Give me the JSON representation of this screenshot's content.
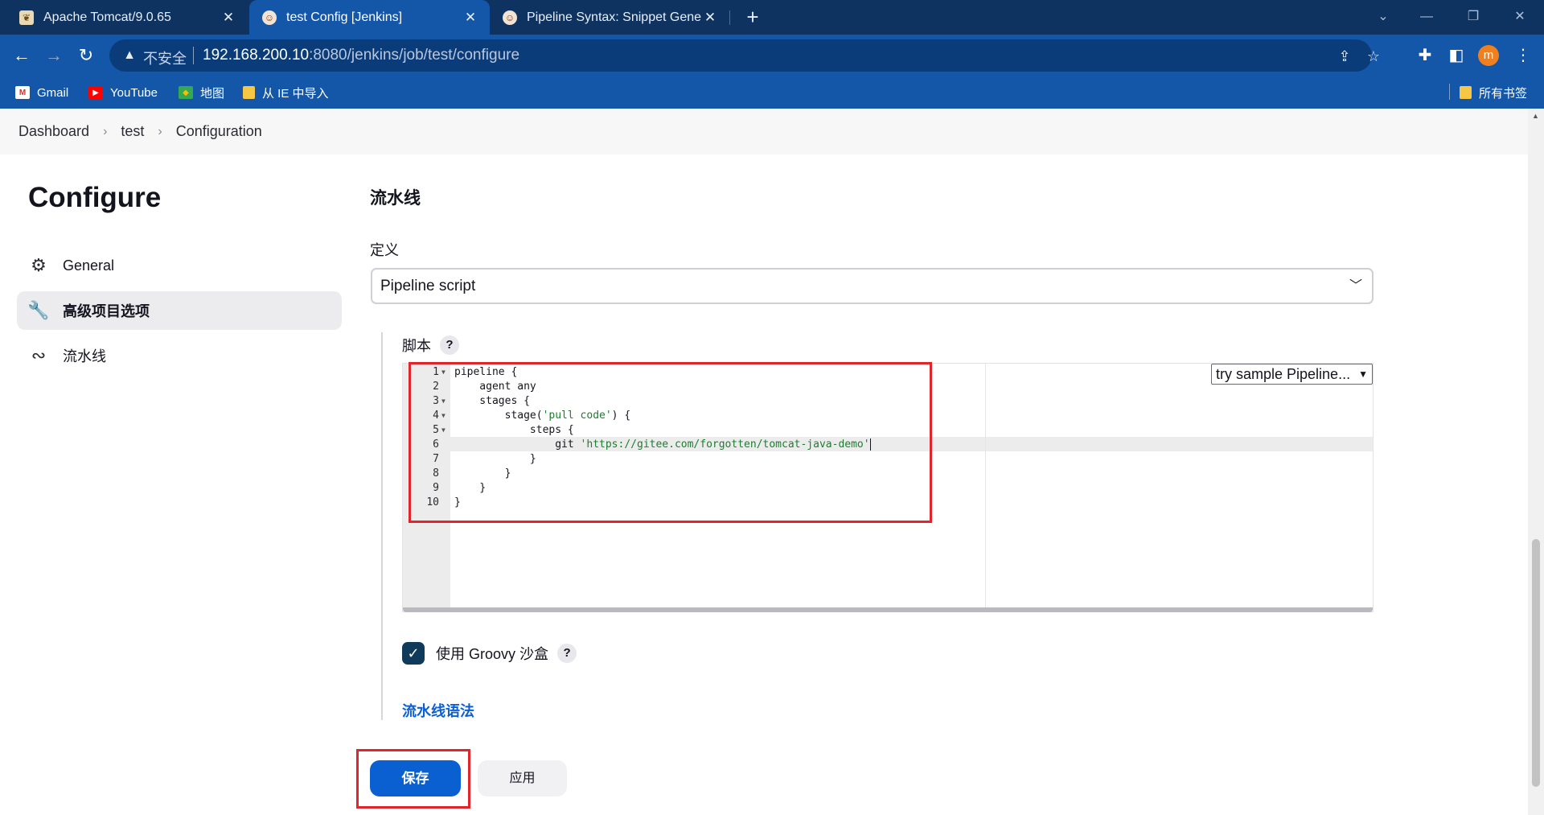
{
  "browser": {
    "tabs": [
      {
        "title": "Apache Tomcat/9.0.65",
        "favicon": "tomcat-icon",
        "active": false
      },
      {
        "title": "test Config [Jenkins]",
        "favicon": "jenkins-icon",
        "active": true
      },
      {
        "title": "Pipeline Syntax: Snippet Gene",
        "favicon": "jenkins-icon",
        "active": false
      }
    ],
    "address": {
      "security_label": "不安全",
      "host": "192.168.200.10",
      "path": ":8080/jenkins/job/test/configure"
    },
    "avatar_letter": "m",
    "bookmarks": [
      {
        "label": "Gmail",
        "icon": "gmail-icon"
      },
      {
        "label": "YouTube",
        "icon": "youtube-icon"
      },
      {
        "label": "地图",
        "icon": "maps-icon"
      },
      {
        "label": "从 IE 中导入",
        "icon": "folder-icon"
      }
    ],
    "all_bookmarks_label": "所有书签"
  },
  "breadcrumb": [
    "Dashboard",
    "test",
    "Configuration"
  ],
  "sidebar": {
    "title": "Configure",
    "items": [
      {
        "label": "General",
        "icon": "gear-icon",
        "active": false
      },
      {
        "label": "高级项目选项",
        "icon": "wrench-icon",
        "active": true
      },
      {
        "label": "流水线",
        "icon": "pipeline-icon",
        "active": false
      }
    ]
  },
  "pipeline": {
    "section_title": "流水线",
    "definition_label": "定义",
    "definition_value": "Pipeline script",
    "script_label": "脚本",
    "sample_select_value": "try sample Pipeline...",
    "code": [
      {
        "n": "1",
        "fold": true,
        "pre": "pipeline {",
        "str": "",
        "post": ""
      },
      {
        "n": "2",
        "fold": false,
        "pre": "    agent any",
        "str": "",
        "post": ""
      },
      {
        "n": "3",
        "fold": true,
        "pre": "    stages {",
        "str": "",
        "post": ""
      },
      {
        "n": "4",
        "fold": true,
        "pre": "        stage(",
        "str": "'pull code'",
        "post": ") {"
      },
      {
        "n": "5",
        "fold": true,
        "pre": "            steps {",
        "str": "",
        "post": ""
      },
      {
        "n": "6",
        "fold": false,
        "pre": "                git ",
        "str": "'https://gitee.com/forgotten/tomcat-java-demo'",
        "post": ""
      },
      {
        "n": "7",
        "fold": false,
        "pre": "            }",
        "str": "",
        "post": ""
      },
      {
        "n": "8",
        "fold": false,
        "pre": "        }",
        "str": "",
        "post": ""
      },
      {
        "n": "9",
        "fold": false,
        "pre": "    }",
        "str": "",
        "post": ""
      },
      {
        "n": "10",
        "fold": false,
        "pre": "}",
        "str": "",
        "post": ""
      }
    ],
    "sandbox_label": "使用 Groovy 沙盒",
    "sandbox_checked": true,
    "syntax_link": "流水线语法"
  },
  "actions": {
    "save_label": "保存",
    "apply_label": "应用"
  },
  "colors": {
    "highlight": "#e0252d",
    "primary": "#0a60d0",
    "chrome": "#1457a8"
  }
}
